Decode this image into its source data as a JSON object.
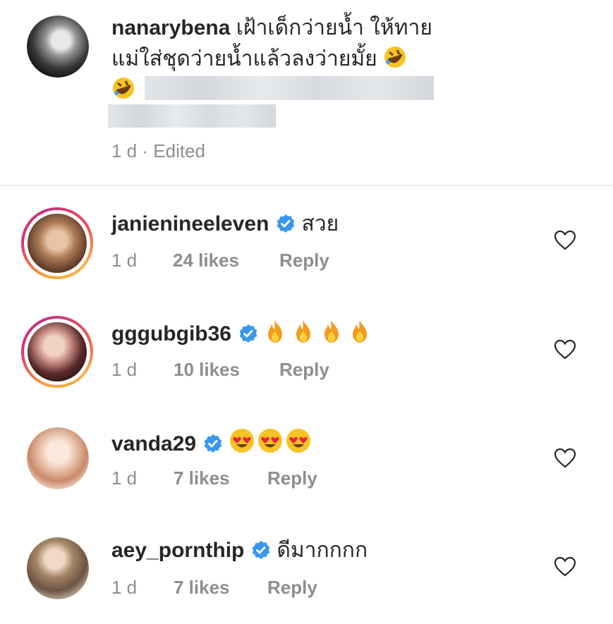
{
  "main_comment": {
    "username": "nanarybena",
    "text_line1": "เฝ้าเด็กว่ายน้ำ ให้ทาย",
    "text_line2": "แม่ใส่ชุดว่ายน้ำแล้วลงว่ายมั้ย",
    "time": "1 d",
    "separator": "·",
    "edited": "Edited",
    "emoji": "rolling-on-floor-laughing-emoji"
  },
  "replies": [
    {
      "username": "janienineeleven",
      "verified": true,
      "text": "สวย",
      "time": "1 d",
      "likes": "24 likes",
      "reply": "Reply",
      "story_ring": true
    },
    {
      "username": "gggubgib36",
      "verified": true,
      "text": "",
      "emoji": "fire-emoji",
      "emoji_count": 4,
      "time": "1 d",
      "likes": "10 likes",
      "reply": "Reply",
      "story_ring": true
    },
    {
      "username": "vanda29",
      "verified": true,
      "text": "",
      "emoji": "heart-eyes-emoji",
      "emoji_count": 3,
      "time": "1 d",
      "likes": "7 likes",
      "reply": "Reply",
      "story_ring": false
    },
    {
      "username": "aey_pornthip",
      "verified": true,
      "text": "ดีมากกกก",
      "time": "1 d",
      "likes": "7 likes",
      "reply": "Reply",
      "story_ring": false
    }
  ],
  "colors": {
    "text": "#262626",
    "secondary": "#8e8e8e",
    "verified_blue": "#3897f0",
    "divider": "#efefef"
  }
}
